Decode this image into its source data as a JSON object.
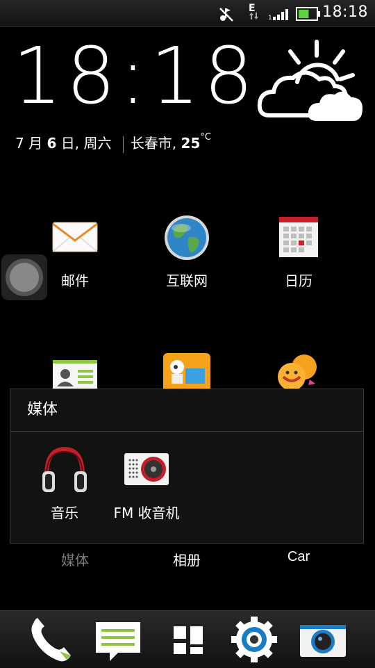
{
  "status_bar": {
    "time": "18:18",
    "network_type": "E",
    "battery_level": 0.6
  },
  "clock": {
    "time": "18:18"
  },
  "date": {
    "month": "7",
    "month_unit": "月",
    "day": "6",
    "day_unit": "日, 周六",
    "city": "长春市,",
    "temperature": "25",
    "temp_unit": "°C"
  },
  "weather": {
    "icon": "partly-cloudy-icon"
  },
  "apps_row1": [
    {
      "label": "邮件",
      "icon": "mail-icon"
    },
    {
      "label": "互联网",
      "icon": "globe-icon"
    },
    {
      "label": "日历",
      "icon": "calendar-icon"
    }
  ],
  "apps_row2_icons": [
    "contacts-icon",
    "market-icon",
    "chat-icon"
  ],
  "folder": {
    "title": "媒体",
    "items": [
      {
        "label": "音乐",
        "icon": "headphones-icon"
      },
      {
        "label": "FM 收音机",
        "icon": "radio-icon"
      }
    ]
  },
  "bottom_labels": [
    "媒体",
    "相册",
    "Car"
  ],
  "dock": [
    "phone-icon",
    "messages-icon",
    "all-apps-icon",
    "settings-icon",
    "camera-icon"
  ],
  "colors": {
    "accent_green": "#8dc63f",
    "battery": "#5fd13a",
    "calendar_red": "#c8202a"
  }
}
